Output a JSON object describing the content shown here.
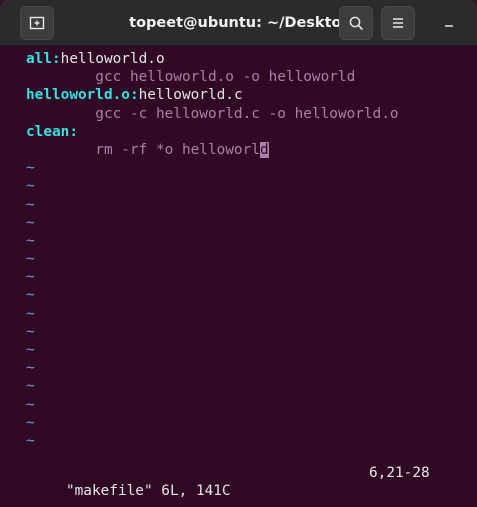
{
  "window": {
    "title": "topeet@ubuntu: ~/Desktop"
  },
  "icons": {
    "new_tab": "new-tab-icon",
    "search": "search-icon",
    "menu": "hamburger-menu-icon",
    "minimize": "minimize-icon"
  },
  "editor": {
    "lines": [
      {
        "target": "all:",
        "rest": "helloworld.o"
      },
      {
        "command": "        gcc helloworld.o -o helloworld"
      },
      {
        "target": "helloworld.o:",
        "rest": "helloworld.c"
      },
      {
        "command": "        gcc -c helloworld.c -o helloworld.o"
      },
      {
        "target": "clean:",
        "rest": ""
      },
      {
        "command": "        rm -rf *o helloworl",
        "cursor_char": "d"
      }
    ],
    "tilde": "~",
    "tilde_count": 16,
    "status_left": "\"makefile\" 6L, 141C",
    "status_right": "6,21-28"
  },
  "colors": {
    "terminal_bg": "#300a24",
    "target": "#34e2e2",
    "command": "#ad7fa8",
    "tilde": "#729fcf",
    "titlebar": "#2b2b2b"
  }
}
